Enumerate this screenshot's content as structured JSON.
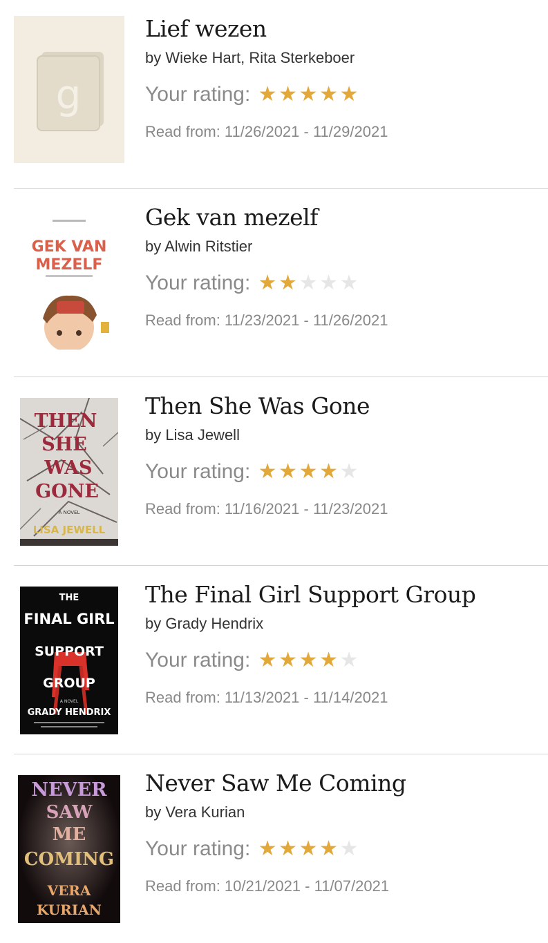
{
  "books": [
    {
      "title": "Lief wezen",
      "author": "by Wieke Hart, Rita Sterkeboer",
      "rating_label": "Your rating:",
      "rating": 5,
      "max_rating": 5,
      "dates": "Read from: 11/26/2021 - 11/29/2021",
      "cover_text": {
        "letter": "g"
      }
    },
    {
      "title": "Gek van mezelf",
      "author": "by Alwin Ritstier",
      "rating_label": "Your rating:",
      "rating": 2,
      "max_rating": 5,
      "dates": "Read from: 11/23/2021 - 11/26/2021",
      "cover_text": {
        "line1": "GEK VAN",
        "line2": "MEZELF"
      }
    },
    {
      "title": "Then She Was Gone",
      "author": "by Lisa Jewell",
      "rating_label": "Your rating:",
      "rating": 4,
      "max_rating": 5,
      "dates": "Read from: 11/16/2021 - 11/23/2021",
      "cover_text": {
        "w1": "THEN",
        "w2": "SHE",
        "w3": "WAS",
        "w4": "GONE",
        "novel": "A NOVEL",
        "author": "LISA JEWELL"
      }
    },
    {
      "title": "The Final Girl Support Group",
      "author": "by Grady Hendrix",
      "rating_label": "Your rating:",
      "rating": 4,
      "max_rating": 5,
      "dates": "Read from: 11/13/2021 - 11/14/2021",
      "cover_text": {
        "w1": "THE",
        "w2": "FINAL GIRL",
        "w3": "SUPPORT",
        "w4": "GROUP",
        "novel": "A NOVEL",
        "author": "GRADY HENDRIX"
      }
    },
    {
      "title": "Never Saw Me Coming",
      "author": "by Vera Kurian",
      "rating_label": "Your rating:",
      "rating": 4,
      "max_rating": 5,
      "dates": "Read from: 10/21/2021 - 11/07/2021",
      "cover_text": {
        "w1": "NEVER",
        "w2": "SAW",
        "w3": "ME",
        "w4": "COMING",
        "a1": "VERA",
        "a2": "KURIAN"
      }
    }
  ],
  "colors": {
    "star_filled": "#e3a83a",
    "star_empty": "#e6e6e6",
    "separator": "#d4d4d4"
  }
}
